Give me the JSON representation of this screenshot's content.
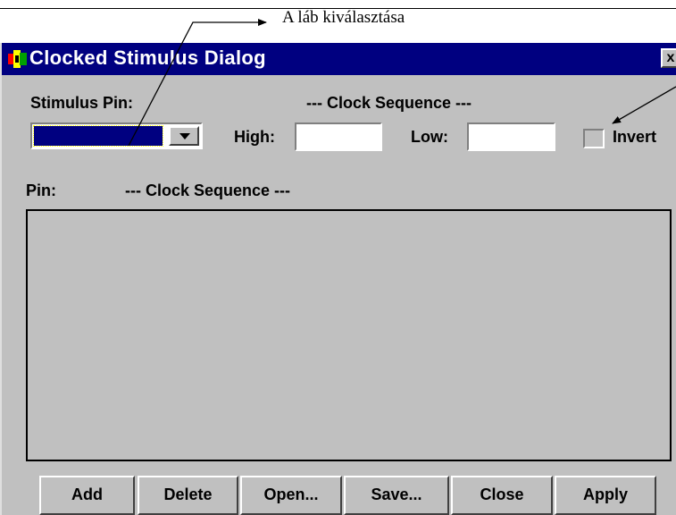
{
  "annotation": {
    "text": "A láb kiválasztása"
  },
  "dialog": {
    "title": "Clocked Stimulus Dialog",
    "close_glyph": "x",
    "stimulus_pin_label": "Stimulus Pin:",
    "clock_sequence_header": "--- Clock Sequence ---",
    "high_label": "High:",
    "high_value": "",
    "low_label": "Low:",
    "low_value": "",
    "invert_label": "Invert",
    "invert_checked": false,
    "pin_column_header": "Pin:",
    "sequence_column_header": "--- Clock Sequence ---",
    "buttons": {
      "add": "Add",
      "delete": "Delete",
      "open": "Open...",
      "save": "Save...",
      "close": "Close",
      "apply": "Apply"
    }
  },
  "colors": {
    "title_bar": "#000080",
    "dialog_face": "#c0c0c0",
    "selection": "#000080"
  },
  "icons": [
    "app-icon",
    "chevron-down-icon",
    "close-icon"
  ]
}
